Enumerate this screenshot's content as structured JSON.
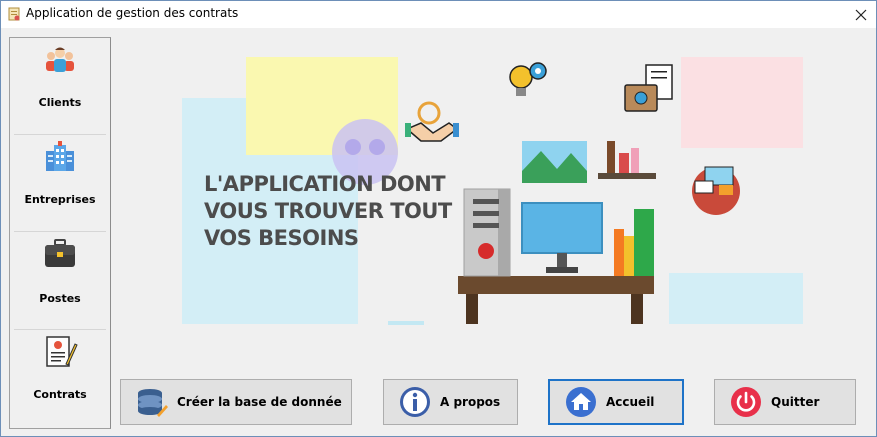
{
  "window": {
    "title": "Application de gestion des contrats"
  },
  "sidebar": {
    "items": [
      {
        "label": "Clients",
        "icon": "people-icon"
      },
      {
        "label": "Entreprises",
        "icon": "building-icon"
      },
      {
        "label": "Postes",
        "icon": "briefcase-icon"
      },
      {
        "label": "Contrats",
        "icon": "contract-icon"
      }
    ]
  },
  "hero": {
    "line1": "L'APPLICATION DONT",
    "line2": "VOUS TROUVER TOUT",
    "line3": "VOS BESOINS"
  },
  "buttons": {
    "create_db": "Créer la base de donnée",
    "about": "A propos",
    "home": "Accueil",
    "quit": "Quitter"
  },
  "colors": {
    "active_border": "#1e73c8",
    "quit_accent": "#e8304a",
    "info_accent": "#3b5ea8",
    "home_accent": "#3a6fd0"
  }
}
